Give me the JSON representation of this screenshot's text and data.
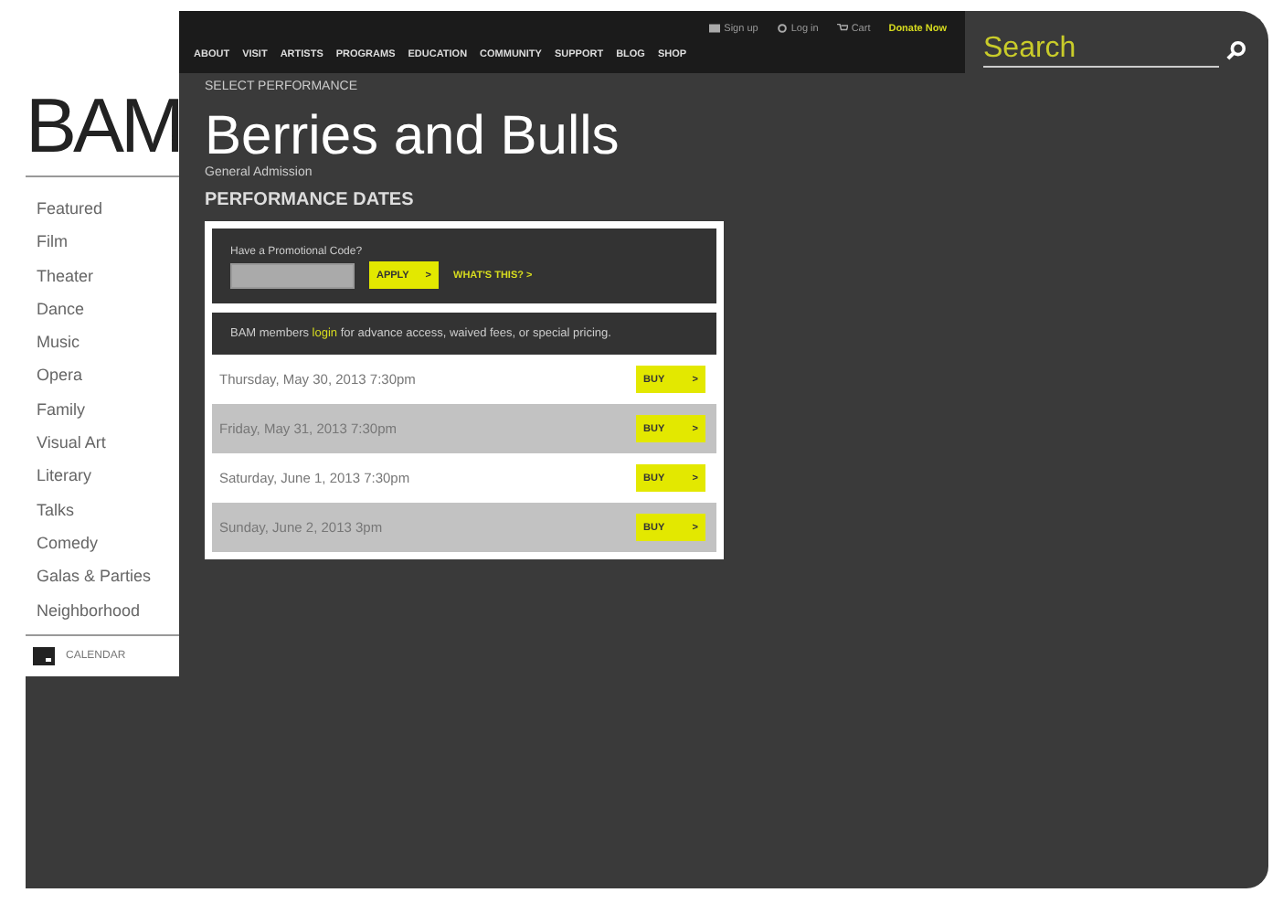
{
  "utility_links": [
    {
      "kind": "signup",
      "label": "Sign up"
    },
    {
      "kind": "login",
      "label": "Log in"
    },
    {
      "kind": "cart",
      "label": "Cart"
    },
    {
      "kind": "donate",
      "label": "Donate Now"
    }
  ],
  "nav": [
    "ABOUT",
    "VISIT",
    "ARTISTS",
    "PROGRAMS",
    "EDUCATION",
    "COMMUNITY",
    "SUPPORT",
    "BLOG",
    "SHOP"
  ],
  "search": {
    "placeholder": "Search"
  },
  "logo": "BAM",
  "sidebar": {
    "items": [
      "Featured",
      "Film",
      "Theater",
      "Dance",
      "Music",
      "Opera",
      "Family",
      "Visual Art",
      "Literary",
      "Talks",
      "Comedy",
      "Galas & Parties",
      "Neighborhood"
    ],
    "calendar": "CALENDAR"
  },
  "breadcrumb": "SELECT PERFORMANCE",
  "title": "Berries and Bulls",
  "subtitle": "General Admission",
  "section_heading": "PERFORMANCE DATES",
  "promo": {
    "label": "Have a Promotional Code?",
    "apply": "APPLY",
    "apply_arrow": ">",
    "whats_this": "WHAT'S THIS? >"
  },
  "members_note": {
    "before": "BAM members ",
    "link": "login",
    "after": " for advance access, waived fees, or special pricing."
  },
  "dates": [
    {
      "date": "Thursday, May 30, 2013 7:30pm",
      "button": "BUY",
      "arrow": ">"
    },
    {
      "date": "Friday, May 31, 2013 7:30pm",
      "button": "BUY",
      "arrow": ">"
    },
    {
      "date": "Saturday, June 1, 2013 7:30pm",
      "button": "BUY",
      "arrow": ">"
    },
    {
      "date": "Sunday, June 2, 2013 3pm",
      "button": "BUY",
      "arrow": ">"
    }
  ]
}
